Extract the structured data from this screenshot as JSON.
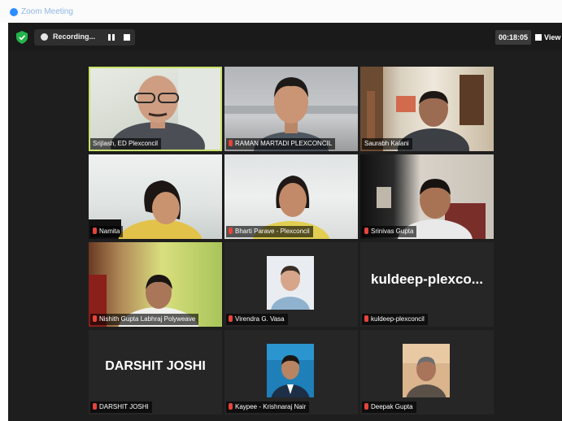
{
  "window": {
    "title": "Zoom Meeting"
  },
  "toolbar": {
    "recording_label": "Recording...",
    "timer": "00:18:05",
    "view_label": "View"
  },
  "participants": [
    {
      "name": "Srijlash, ED Plexconcil",
      "type": "video",
      "active_speaker": true,
      "muted": false
    },
    {
      "name": "RAMAN MARTADI PLEXCONCIL",
      "type": "video",
      "muted": true
    },
    {
      "name": "Saurabh Kalani",
      "type": "video",
      "muted": true
    },
    {
      "name": "Namita",
      "type": "video",
      "muted": true
    },
    {
      "name": "Bharti Parave - Plexconcil",
      "type": "video",
      "muted": true
    },
    {
      "name": "Srinivas Gupta",
      "type": "video",
      "muted": true
    },
    {
      "name": "Nishith Gupta Labhraj Polyweave",
      "type": "video",
      "muted": true
    },
    {
      "name": "Virendra G. Vasa",
      "type": "profile",
      "muted": true
    },
    {
      "name": "kuldeep-plexconcil",
      "type": "name",
      "display": "kuldeep-plexco...",
      "muted": true
    },
    {
      "name": "DARSHIT JOSHI",
      "type": "name",
      "display": "DARSHIT JOSHI",
      "muted": true
    },
    {
      "name": "Kaypee - Krishnaraj Nair",
      "type": "profile",
      "muted": true
    },
    {
      "name": "Deepak Gupta",
      "type": "profile",
      "muted": true
    }
  ],
  "colors": {
    "stage_background": "#1e1e1e",
    "tile_background": "#262626",
    "active_speaker_border": "#c9e26a",
    "muted_mic": "#e8433a"
  }
}
